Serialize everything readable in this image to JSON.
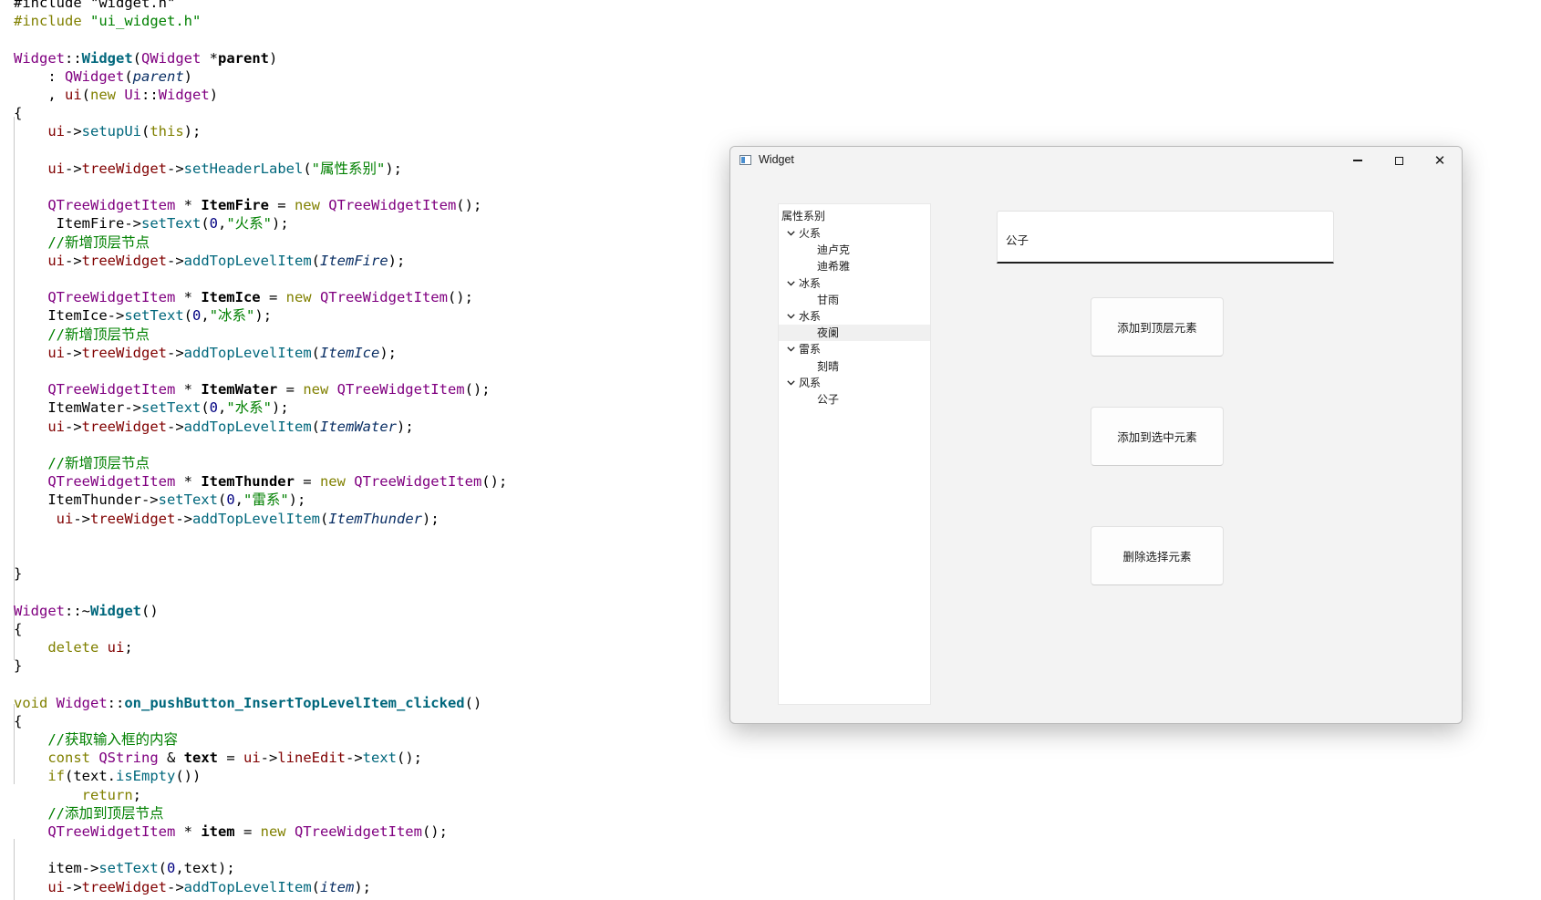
{
  "editor": {
    "lines": [
      [
        [
          "tok-op",
          "#include \"widget.h\""
        ]
      ],
      [
        [
          "tok-kw",
          "#include "
        ],
        [
          "tok-str",
          "\"ui_widget.h\""
        ]
      ],
      [],
      [
        [
          "tok-type",
          "Widget"
        ],
        [
          "tok-op",
          "::"
        ],
        [
          "tok-fnb",
          "Widget"
        ],
        [
          "tok-op",
          "("
        ],
        [
          "tok-type",
          "QWidget"
        ],
        [
          "tok-op",
          " *"
        ],
        [
          "tok-bold",
          "parent"
        ],
        [
          "tok-op",
          ")"
        ]
      ],
      [
        [
          "tok-op",
          "    : "
        ],
        [
          "tok-type",
          "QWidget"
        ],
        [
          "tok-op",
          "("
        ],
        [
          "tok-arg",
          "parent"
        ],
        [
          "tok-op",
          ")"
        ]
      ],
      [
        [
          "tok-op",
          "    , "
        ],
        [
          "tok-memb",
          "ui"
        ],
        [
          "tok-op",
          "("
        ],
        [
          "tok-kw",
          "new "
        ],
        [
          "tok-type",
          "Ui"
        ],
        [
          "tok-op",
          "::"
        ],
        [
          "tok-type",
          "Widget"
        ],
        [
          "tok-op",
          ")"
        ]
      ],
      [
        [
          "tok-op",
          "{"
        ]
      ],
      [
        [
          "tok-op",
          "    "
        ],
        [
          "tok-memb",
          "ui"
        ],
        [
          "tok-op",
          "->"
        ],
        [
          "tok-fn",
          "setupUi"
        ],
        [
          "tok-op",
          "("
        ],
        [
          "tok-kw",
          "this"
        ],
        [
          "tok-op",
          ");"
        ]
      ],
      [],
      [
        [
          "tok-op",
          "    "
        ],
        [
          "tok-memb",
          "ui"
        ],
        [
          "tok-op",
          "->"
        ],
        [
          "tok-memb",
          "treeWidget"
        ],
        [
          "tok-op",
          "->"
        ],
        [
          "tok-fn",
          "setHeaderLabel"
        ],
        [
          "tok-op",
          "("
        ],
        [
          "tok-str",
          "\"属性系别\""
        ],
        [
          "tok-op",
          ");"
        ]
      ],
      [],
      [
        [
          "tok-op",
          "    "
        ],
        [
          "tok-type",
          "QTreeWidgetItem"
        ],
        [
          "tok-op",
          " * "
        ],
        [
          "tok-bold",
          "ItemFire"
        ],
        [
          "tok-op",
          " = "
        ],
        [
          "tok-kw",
          "new "
        ],
        [
          "tok-type",
          "QTreeWidgetItem"
        ],
        [
          "tok-op",
          "();"
        ]
      ],
      [
        [
          "tok-op",
          "     ItemFire->"
        ],
        [
          "tok-fn",
          "setText"
        ],
        [
          "tok-op",
          "("
        ],
        [
          "tok-num",
          "0"
        ],
        [
          "tok-op",
          ","
        ],
        [
          "tok-str",
          "\"火系\""
        ],
        [
          "tok-op",
          ");"
        ]
      ],
      [
        [
          "tok-op",
          "    "
        ],
        [
          "tok-cmt",
          "//新增顶层节点"
        ]
      ],
      [
        [
          "tok-op",
          "    "
        ],
        [
          "tok-memb",
          "ui"
        ],
        [
          "tok-op",
          "->"
        ],
        [
          "tok-memb",
          "treeWidget"
        ],
        [
          "tok-op",
          "->"
        ],
        [
          "tok-fn",
          "addTopLevelItem"
        ],
        [
          "tok-op",
          "("
        ],
        [
          "tok-arg",
          "ItemFire"
        ],
        [
          "tok-op",
          ");"
        ]
      ],
      [],
      [
        [
          "tok-op",
          "    "
        ],
        [
          "tok-type",
          "QTreeWidgetItem"
        ],
        [
          "tok-op",
          " * "
        ],
        [
          "tok-bold",
          "ItemIce"
        ],
        [
          "tok-op",
          " = "
        ],
        [
          "tok-kw",
          "new "
        ],
        [
          "tok-type",
          "QTreeWidgetItem"
        ],
        [
          "tok-op",
          "();"
        ]
      ],
      [
        [
          "tok-op",
          "    ItemIce->"
        ],
        [
          "tok-fn",
          "setText"
        ],
        [
          "tok-op",
          "("
        ],
        [
          "tok-num",
          "0"
        ],
        [
          "tok-op",
          ","
        ],
        [
          "tok-str",
          "\"冰系\""
        ],
        [
          "tok-op",
          ");"
        ]
      ],
      [
        [
          "tok-op",
          "    "
        ],
        [
          "tok-cmt",
          "//新增顶层节点"
        ]
      ],
      [
        [
          "tok-op",
          "    "
        ],
        [
          "tok-memb",
          "ui"
        ],
        [
          "tok-op",
          "->"
        ],
        [
          "tok-memb",
          "treeWidget"
        ],
        [
          "tok-op",
          "->"
        ],
        [
          "tok-fn",
          "addTopLevelItem"
        ],
        [
          "tok-op",
          "("
        ],
        [
          "tok-arg",
          "ItemIce"
        ],
        [
          "tok-op",
          ");"
        ]
      ],
      [],
      [
        [
          "tok-op",
          "    "
        ],
        [
          "tok-type",
          "QTreeWidgetItem"
        ],
        [
          "tok-op",
          " * "
        ],
        [
          "tok-bold",
          "ItemWater"
        ],
        [
          "tok-op",
          " = "
        ],
        [
          "tok-kw",
          "new "
        ],
        [
          "tok-type",
          "QTreeWidgetItem"
        ],
        [
          "tok-op",
          "();"
        ]
      ],
      [
        [
          "tok-op",
          "    ItemWater->"
        ],
        [
          "tok-fn",
          "setText"
        ],
        [
          "tok-op",
          "("
        ],
        [
          "tok-num",
          "0"
        ],
        [
          "tok-op",
          ","
        ],
        [
          "tok-str",
          "\"水系\""
        ],
        [
          "tok-op",
          ");"
        ]
      ],
      [
        [
          "tok-op",
          "    "
        ],
        [
          "tok-memb",
          "ui"
        ],
        [
          "tok-op",
          "->"
        ],
        [
          "tok-memb",
          "treeWidget"
        ],
        [
          "tok-op",
          "->"
        ],
        [
          "tok-fn",
          "addTopLevelItem"
        ],
        [
          "tok-op",
          "("
        ],
        [
          "tok-arg",
          "ItemWater"
        ],
        [
          "tok-op",
          ");"
        ]
      ],
      [],
      [
        [
          "tok-op",
          "    "
        ],
        [
          "tok-cmt",
          "//新增顶层节点"
        ]
      ],
      [
        [
          "tok-op",
          "    "
        ],
        [
          "tok-type",
          "QTreeWidgetItem"
        ],
        [
          "tok-op",
          " * "
        ],
        [
          "tok-bold",
          "ItemThunder"
        ],
        [
          "tok-op",
          " = "
        ],
        [
          "tok-kw",
          "new "
        ],
        [
          "tok-type",
          "QTreeWidgetItem"
        ],
        [
          "tok-op",
          "();"
        ]
      ],
      [
        [
          "tok-op",
          "    ItemThunder->"
        ],
        [
          "tok-fn",
          "setText"
        ],
        [
          "tok-op",
          "("
        ],
        [
          "tok-num",
          "0"
        ],
        [
          "tok-op",
          ","
        ],
        [
          "tok-str",
          "\"雷系\""
        ],
        [
          "tok-op",
          ");"
        ]
      ],
      [
        [
          "tok-op",
          "     "
        ],
        [
          "tok-memb",
          "ui"
        ],
        [
          "tok-op",
          "->"
        ],
        [
          "tok-memb",
          "treeWidget"
        ],
        [
          "tok-op",
          "->"
        ],
        [
          "tok-fn",
          "addTopLevelItem"
        ],
        [
          "tok-op",
          "("
        ],
        [
          "tok-arg",
          "ItemThunder"
        ],
        [
          "tok-op",
          ");"
        ]
      ],
      [],
      [],
      [
        [
          "tok-op",
          "}"
        ]
      ],
      [],
      [
        [
          "tok-type",
          "Widget"
        ],
        [
          "tok-op",
          "::~"
        ],
        [
          "tok-fnb",
          "Widget"
        ],
        [
          "tok-op",
          "()"
        ]
      ],
      [
        [
          "tok-op",
          "{"
        ]
      ],
      [
        [
          "tok-op",
          "    "
        ],
        [
          "tok-kw",
          "delete "
        ],
        [
          "tok-memb",
          "ui"
        ],
        [
          "tok-op",
          ";"
        ]
      ],
      [
        [
          "tok-op",
          "}"
        ]
      ],
      [],
      [
        [
          "tok-kw",
          "void "
        ],
        [
          "tok-type",
          "Widget"
        ],
        [
          "tok-op",
          "::"
        ],
        [
          "tok-fnb",
          "on_pushButton_InsertTopLevelItem_clicked"
        ],
        [
          "tok-op",
          "()"
        ]
      ],
      [
        [
          "tok-op",
          "{"
        ]
      ],
      [
        [
          "tok-op",
          "    "
        ],
        [
          "tok-cmt",
          "//获取输入框的内容"
        ]
      ],
      [
        [
          "tok-op",
          "    "
        ],
        [
          "tok-kw",
          "const "
        ],
        [
          "tok-type",
          "QString"
        ],
        [
          "tok-op",
          " & "
        ],
        [
          "tok-bold",
          "text"
        ],
        [
          "tok-op",
          " = "
        ],
        [
          "tok-memb",
          "ui"
        ],
        [
          "tok-op",
          "->"
        ],
        [
          "tok-memb",
          "lineEdit"
        ],
        [
          "tok-op",
          "->"
        ],
        [
          "tok-fn",
          "text"
        ],
        [
          "tok-op",
          "();"
        ]
      ],
      [
        [
          "tok-op",
          "    "
        ],
        [
          "tok-kw",
          "if"
        ],
        [
          "tok-op",
          "(text."
        ],
        [
          "tok-fn",
          "isEmpty"
        ],
        [
          "tok-op",
          "())"
        ]
      ],
      [
        [
          "tok-op",
          "        "
        ],
        [
          "tok-kw",
          "return"
        ],
        [
          "tok-op",
          ";"
        ]
      ],
      [
        [
          "tok-op",
          "    "
        ],
        [
          "tok-cmt",
          "//添加到顶层节点"
        ]
      ],
      [
        [
          "tok-op",
          "    "
        ],
        [
          "tok-type",
          "QTreeWidgetItem"
        ],
        [
          "tok-op",
          " * "
        ],
        [
          "tok-bold",
          "item"
        ],
        [
          "tok-op",
          " = "
        ],
        [
          "tok-kw",
          "new "
        ],
        [
          "tok-type",
          "QTreeWidgetItem"
        ],
        [
          "tok-op",
          "();"
        ]
      ],
      [],
      [
        [
          "tok-op",
          "    item->"
        ],
        [
          "tok-fn",
          "setText"
        ],
        [
          "tok-op",
          "("
        ],
        [
          "tok-num",
          "0"
        ],
        [
          "tok-op",
          ",text);"
        ]
      ],
      [
        [
          "tok-op",
          "    "
        ],
        [
          "tok-memb",
          "ui"
        ],
        [
          "tok-op",
          "->"
        ],
        [
          "tok-memb",
          "treeWidget"
        ],
        [
          "tok-op",
          "->"
        ],
        [
          "tok-fn",
          "addTopLevelItem"
        ],
        [
          "tok-op",
          "("
        ],
        [
          "tok-arg",
          "item"
        ],
        [
          "tok-op",
          ");"
        ]
      ]
    ]
  },
  "window": {
    "title": "Widget",
    "min_label": "−",
    "close_label": "✕"
  },
  "tree": {
    "header": "属性系别",
    "rows": [
      {
        "label": "火系",
        "level": 0
      },
      {
        "label": "迪卢克",
        "level": 1
      },
      {
        "label": "迪希雅",
        "level": 1
      },
      {
        "label": "冰系",
        "level": 0
      },
      {
        "label": "甘雨",
        "level": 1
      },
      {
        "label": "水系",
        "level": 0
      },
      {
        "label": "夜阑",
        "level": 1,
        "selected": true
      },
      {
        "label": "雷系",
        "level": 0
      },
      {
        "label": "刻晴",
        "level": 1
      },
      {
        "label": "风系",
        "level": 0
      },
      {
        "label": "公子",
        "level": 1
      }
    ]
  },
  "line_edit": {
    "value": "公子"
  },
  "buttons": {
    "insert_top": "添加到顶层元素",
    "insert_child": "添加到选中元素",
    "delete": "删除选择元素"
  }
}
